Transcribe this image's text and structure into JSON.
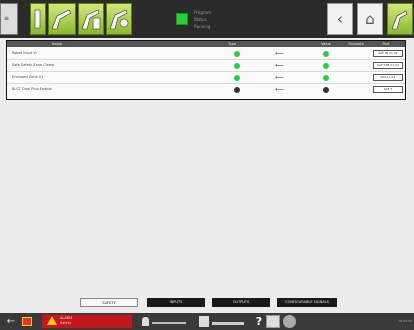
{
  "toolbar": {
    "menu_icon": "menu-icon",
    "tools": [
      {
        "name": "jog-tool",
        "icon": "jog-icon"
      },
      {
        "name": "robot-tool",
        "icon": "robot-arm-icon"
      },
      {
        "name": "program-tool",
        "icon": "program-icon"
      },
      {
        "name": "setup-tool",
        "icon": "setup-icon"
      }
    ],
    "status": {
      "line1": "Program",
      "line2": "Status",
      "line3": "Running"
    },
    "back_icon": "back-icon",
    "home_icon": "home-icon",
    "robot_icon": "robot-icon",
    "accent": "#8db82c"
  },
  "io_table": {
    "headers": {
      "name": "Name",
      "type": "Type",
      "value": "Value",
      "simulate": "Simulate",
      "port": "Port"
    },
    "rows": [
      {
        "name": "Robot Input In",
        "state": "on",
        "value_state": "on",
        "port": "SAF IN 01 02"
      },
      {
        "name": "Safe Safety Zone Clamp",
        "state": "on",
        "value_state": "on",
        "port": "SAF STB 01 02"
      },
      {
        "name": "Enclosed Zone 01",
        "state": "on",
        "value_state": "on",
        "port": "SAF Lc 01"
      },
      {
        "name": "BLCT Dual Plug Enable",
        "state": "off",
        "value_state": "off",
        "port": "SAF T"
      }
    ],
    "on_color": "#2ecc40",
    "off_color": "#333333"
  },
  "tabs": [
    {
      "key": "safety",
      "label": "SAFETY",
      "active": true
    },
    {
      "key": "inputs",
      "label": "INPUTS",
      "active": false
    },
    {
      "key": "outputs",
      "label": "OUTPUTS",
      "active": false
    },
    {
      "key": "config",
      "label": "CONFIGURABLE SIGNALS",
      "active": false
    }
  ],
  "statusbar": {
    "alarm_line1": "ALARM",
    "alarm_line2": "Safety",
    "user": "Operator",
    "jog": "World",
    "help": "?",
    "time": "00:00:00"
  }
}
